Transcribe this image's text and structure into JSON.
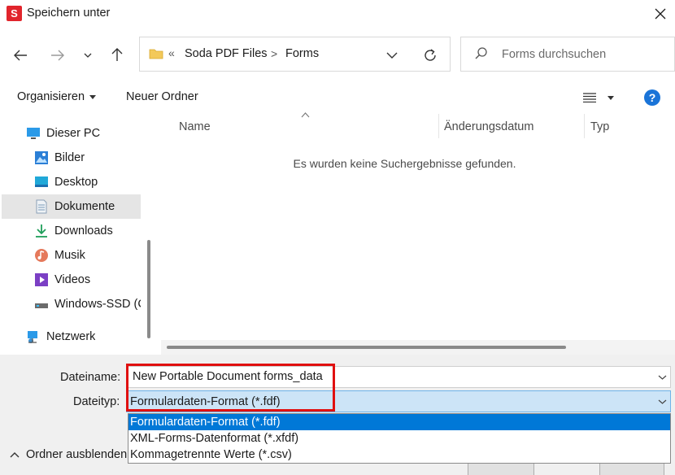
{
  "window": {
    "title": "Speichern unter",
    "app_logo": "S"
  },
  "breadcrumb": {
    "overflow": "«",
    "items": [
      "Soda PDF Files",
      "Forms"
    ],
    "separator": ">"
  },
  "search": {
    "placeholder": "Forms durchsuchen"
  },
  "toolbar": {
    "organise_label": "Organisieren",
    "new_folder_label": "Neuer Ordner",
    "help_label": "?"
  },
  "sidebar": {
    "items": [
      {
        "label": "Dieser PC",
        "icon": "pc-icon"
      },
      {
        "label": "Bilder",
        "icon": "pictures-icon"
      },
      {
        "label": "Desktop",
        "icon": "desktop-icon"
      },
      {
        "label": "Dokumente",
        "icon": "documents-icon",
        "selected": true
      },
      {
        "label": "Downloads",
        "icon": "downloads-icon"
      },
      {
        "label": "Musik",
        "icon": "music-icon"
      },
      {
        "label": "Videos",
        "icon": "videos-icon"
      },
      {
        "label": "Windows-SSD (C",
        "icon": "drive-icon"
      },
      {
        "label": "Netzwerk",
        "icon": "network-icon"
      }
    ]
  },
  "file_list": {
    "columns": [
      "Name",
      "Änderungsdatum",
      "Typ"
    ],
    "empty_message": "Es wurden keine Suchergebnisse gefunden."
  },
  "form": {
    "filename_label": "Dateiname:",
    "filename_value": "New Portable Document forms_data",
    "filetype_label": "Dateityp:",
    "filetype_value": "Formulardaten-Format (*.fdf)",
    "filetype_options": [
      "Formulardaten-Format (*.fdf)",
      "XML-Forms-Datenformat (*.xfdf)",
      "Kommagetrennte Werte (*.csv)"
    ]
  },
  "footer": {
    "hide_folders_label": "Ordner ausblenden"
  },
  "colors": {
    "accent": "#0078d7",
    "highlight_red": "#e01010",
    "selected_bg": "#cce4f7",
    "app_red": "#e1252c"
  }
}
